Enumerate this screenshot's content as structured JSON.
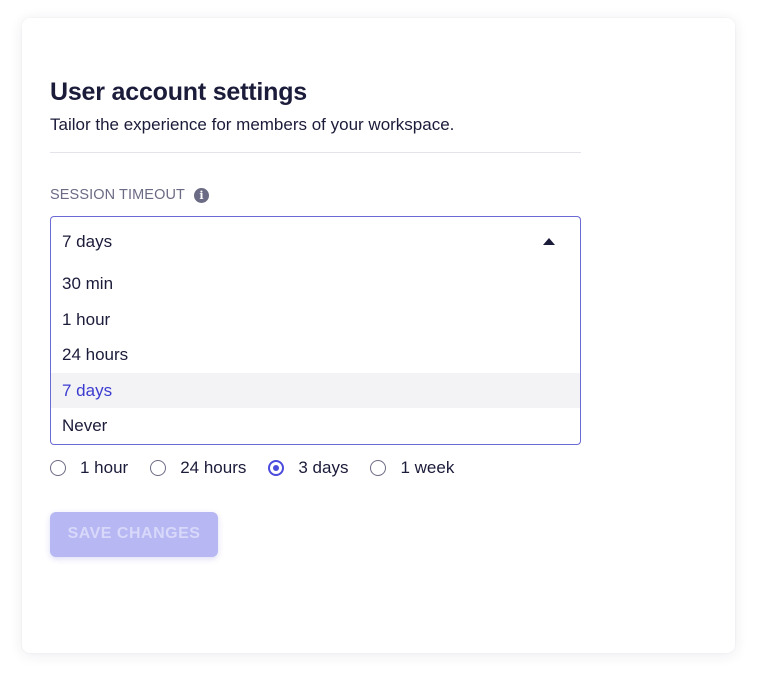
{
  "settings": {
    "title": "User account settings",
    "subtitle": "Tailor the experience for members of your workspace."
  },
  "session_timeout": {
    "label": "SESSION TIMEOUT",
    "info_icon_glyph": "i",
    "info_icon": "info-icon",
    "selected_value": "7 days",
    "dropdown_open": true,
    "caret_icon": "caret-up-icon",
    "options": [
      {
        "label": "30 min",
        "selected": false
      },
      {
        "label": "1 hour",
        "selected": false
      },
      {
        "label": "24 hours",
        "selected": false
      },
      {
        "label": "7 days",
        "selected": true
      },
      {
        "label": "Never",
        "selected": false
      }
    ]
  },
  "radio_group": {
    "options": [
      {
        "label": "1 hour",
        "checked": false
      },
      {
        "label": "24 hours",
        "checked": false
      },
      {
        "label": "3 days",
        "checked": true
      },
      {
        "label": "1 week",
        "checked": false
      }
    ]
  },
  "actions": {
    "save_label": "SAVE CHANGES",
    "save_disabled": true
  },
  "colors": {
    "accent": "#4b4bdc",
    "selected_option_text": "#3b3bd0",
    "selected_option_bg": "#f3f3f6",
    "button_disabled_bg": "#b7b7f3",
    "text": "#1b1b3a",
    "muted": "#6b6b85"
  }
}
